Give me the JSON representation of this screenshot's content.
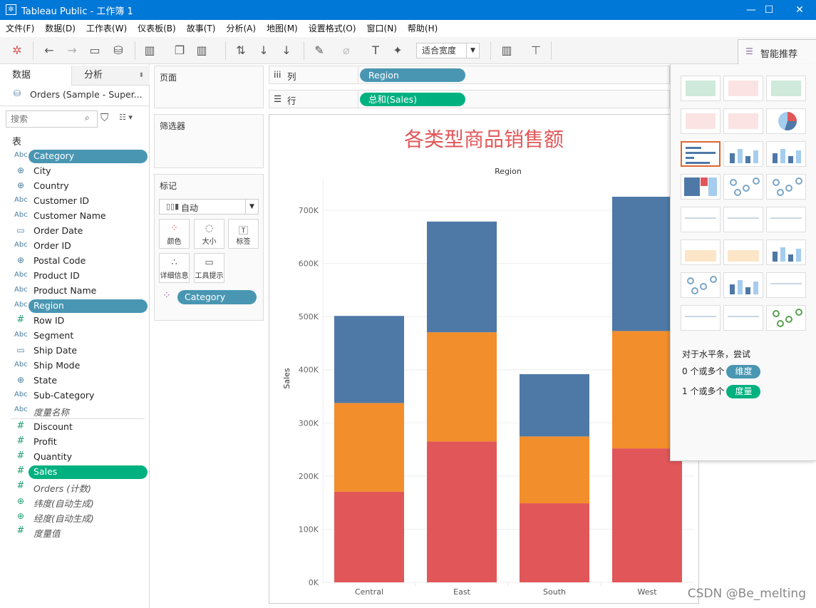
{
  "window": {
    "title": "Tableau Public - 工作簿 1",
    "controls": [
      "—",
      "☐",
      "✕"
    ]
  },
  "menu": [
    "文件(F)",
    "数据(D)",
    "工作表(W)",
    "仪表板(B)",
    "故事(T)",
    "分析(A)",
    "地图(M)",
    "设置格式(O)",
    "窗口(N)",
    "帮助(H)"
  ],
  "toolbar": {
    "fit_select": "适合宽度"
  },
  "left": {
    "tab_data": "数据",
    "tab_analysis": "分析",
    "datasource": "Orders (Sample - Super...",
    "search_placeholder": "搜索",
    "section": "表",
    "dimensions": [
      {
        "icon": "Abc",
        "label": "Category",
        "pill": true
      },
      {
        "icon": "globe",
        "label": "City"
      },
      {
        "icon": "globe",
        "label": "Country"
      },
      {
        "icon": "Abc",
        "label": "Customer ID"
      },
      {
        "icon": "Abc",
        "label": "Customer Name"
      },
      {
        "icon": "date",
        "label": "Order Date"
      },
      {
        "icon": "Abc",
        "label": "Order ID"
      },
      {
        "icon": "globe",
        "label": "Postal Code"
      },
      {
        "icon": "Abc",
        "label": "Product ID"
      },
      {
        "icon": "Abc",
        "label": "Product Name"
      },
      {
        "icon": "Abc",
        "label": "Region",
        "pill": true
      },
      {
        "icon": "#",
        "label": "Row ID"
      },
      {
        "icon": "Abc",
        "label": "Segment"
      },
      {
        "icon": "date",
        "label": "Ship Date"
      },
      {
        "icon": "Abc",
        "label": "Ship Mode"
      },
      {
        "icon": "globe",
        "label": "State"
      },
      {
        "icon": "Abc",
        "label": "Sub-Category"
      },
      {
        "icon": "Abc",
        "label": "度量名称",
        "italic": true
      }
    ],
    "measures": [
      {
        "icon": "#",
        "label": "Discount"
      },
      {
        "icon": "#",
        "label": "Profit"
      },
      {
        "icon": "#",
        "label": "Quantity"
      },
      {
        "icon": "#",
        "label": "Sales",
        "pill": true
      },
      {
        "icon": "#",
        "label": "Orders (计数)",
        "italic": true
      },
      {
        "icon": "globe",
        "label": "纬度(自动生成)",
        "italic": true
      },
      {
        "icon": "globe",
        "label": "经度(自动生成)",
        "italic": true
      },
      {
        "icon": "#",
        "label": "度量值",
        "italic": true
      }
    ]
  },
  "cards": {
    "pages": "页面",
    "filters": "筛选器",
    "marks": "标记",
    "mark_type": "自动",
    "buttons": [
      "颜色",
      "大小",
      "标签",
      "详细信息",
      "工具提示"
    ],
    "color_pill": "Category"
  },
  "shelves": {
    "columns_label": "列",
    "columns_pill": "Region",
    "rows_label": "行",
    "rows_pill": "总和(Sales)"
  },
  "colors": {
    "dimension": "#4996b2",
    "measure": "#00b180",
    "title": "#e15759",
    "furniture": "#4e79a7",
    "office": "#f28e2b",
    "technology": "#e15759"
  },
  "chart_data": {
    "type": "bar",
    "stacked": true,
    "title": "各类型商品销售额",
    "column_header": "Region",
    "ylabel": "Sales",
    "categories": [
      "Central",
      "East",
      "South",
      "West"
    ],
    "yticks": [
      "0K",
      "100K",
      "200K",
      "300K",
      "400K",
      "500K",
      "600K",
      "700K"
    ],
    "ylim": [
      0,
      750000
    ],
    "grid": true,
    "series": [
      {
        "color": "#e15759",
        "values": [
          170416,
          264974,
          148772,
          251992
        ]
      },
      {
        "color": "#f28e2b",
        "values": [
          167026,
          205516,
          125651,
          220853
        ]
      },
      {
        "color": "#4e79a7",
        "values": [
          163797,
          208291,
          117299,
          252613
        ]
      }
    ]
  },
  "showme": {
    "tab": "智能推荐",
    "thumbs": [
      "text-table",
      "heat-map",
      "highlight-table",
      "symbol-map",
      "filled-map",
      "pie",
      "horizontal-bars",
      "stacked-bars",
      "side-by-side-bars",
      "treemap",
      "circle-views",
      "side-by-side-circles",
      "line-continuous",
      "line-discrete",
      "dual-line",
      "area-continuous",
      "area-discrete",
      "dual-combination",
      "scatter",
      "histogram",
      "box-whisker",
      "gantt",
      "bullet",
      "packed-bubbles"
    ],
    "selected": "horizontal-bars",
    "hint": "对于水平条，尝试",
    "dim_prefix": "0 个或多个",
    "dim_pill": "维度",
    "meas_prefix": "1 个或多个",
    "meas_pill": "度量"
  },
  "watermark": "CSDN @Be_melting"
}
